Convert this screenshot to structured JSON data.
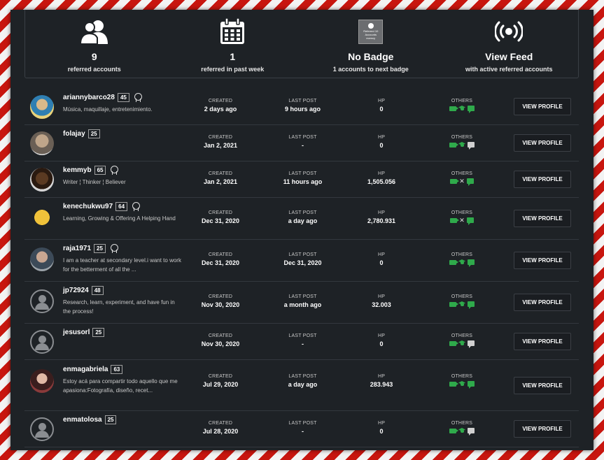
{
  "stats": [
    {
      "icon": "users-icon",
      "value": "9",
      "label": "referred accounts"
    },
    {
      "icon": "calendar-icon",
      "value": "1",
      "label": "referred in past week"
    },
    {
      "icon": "badge-image",
      "value": "No Badge",
      "label": "1 accounts to next badge"
    },
    {
      "icon": "broadcast-icon",
      "value": "View Feed",
      "label": "with active referred accounts"
    }
  ],
  "badge_image_text": [
    "Referred 10",
    "Accounts",
    "ecency"
  ],
  "columns": {
    "created": "CREATED",
    "last_post": "LAST POST",
    "hp": "HP",
    "others": "OTHERS"
  },
  "view_profile_label": "VIEW PROFILE",
  "users": [
    {
      "name": "ariannybarco28",
      "rep": "45",
      "medal": true,
      "bio": "Música, maquillaje, entretenimiento.",
      "created": "2 days ago",
      "last_post": "9 hours ago",
      "hp": "0",
      "others": [
        "cam",
        "grad",
        "chat-green"
      ]
    },
    {
      "name": "folajay",
      "rep": "25",
      "medal": false,
      "bio": "",
      "created": "Jan 2, 2021",
      "last_post": "-",
      "hp": "0",
      "others": [
        "cam",
        "grad",
        "chat-white"
      ]
    },
    {
      "name": "kemmyb",
      "rep": "65",
      "medal": true,
      "bio": "Writer ¦ Thinker ¦ Believer",
      "created": "Jan 2, 2021",
      "last_post": "11 hours ago",
      "hp": "1,505.056",
      "others": [
        "cam",
        "x",
        "chat-green"
      ]
    },
    {
      "name": "kenechukwu97",
      "rep": "64",
      "medal": true,
      "bio": "Learning, Growing & Offering A Helping Hand",
      "created": "Dec 31, 2020",
      "last_post": "a day ago",
      "hp": "2,780.931",
      "others": [
        "cam",
        "x",
        "chat-green"
      ]
    },
    {
      "name": "raja1971",
      "rep": "25",
      "medal": true,
      "bio": "I am a teacher at secondary level.i want to work for the betterment of all the ...",
      "created": "Dec 31, 2020",
      "last_post": "Dec 31, 2020",
      "hp": "0",
      "others": [
        "cam",
        "grad",
        "chat-green"
      ]
    },
    {
      "name": "jp72924",
      "rep": "48",
      "medal": false,
      "bio": "Research, learn, experiment, and have fun in the process!",
      "created": "Nov 30, 2020",
      "last_post": "a month ago",
      "hp": "32.003",
      "others": [
        "cam",
        "grad",
        "chat-green"
      ]
    },
    {
      "name": "jesusorl",
      "rep": "25",
      "medal": false,
      "bio": "",
      "created": "Nov 30, 2020",
      "last_post": "-",
      "hp": "0",
      "others": [
        "cam",
        "grad",
        "chat-white"
      ]
    },
    {
      "name": "enmagabriela",
      "rep": "63",
      "medal": false,
      "bio": "Estoy acá para compartir todo aquello que me apasiona:Fotografía, diseño, recet...",
      "created": "Jul 29, 2020",
      "last_post": "a day ago",
      "hp": "283.943",
      "others": [
        "cam",
        "grad",
        "chat-green"
      ]
    },
    {
      "name": "enmatolosa",
      "rep": "25",
      "medal": false,
      "bio": "",
      "created": "Jul 28, 2020",
      "last_post": "-",
      "hp": "0",
      "others": [
        "cam",
        "grad",
        "chat-white"
      ]
    }
  ]
}
